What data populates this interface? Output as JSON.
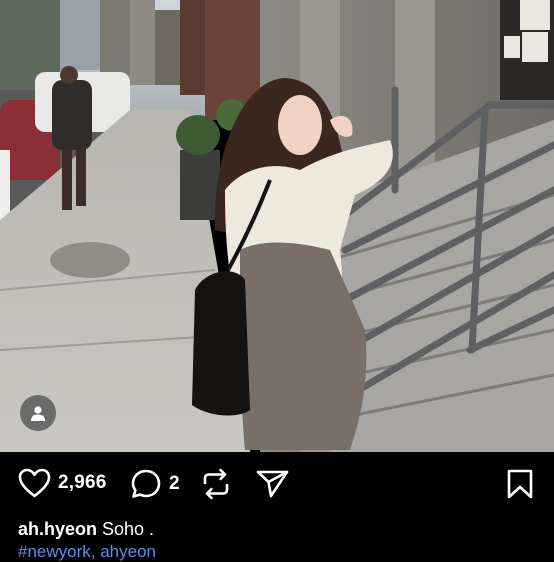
{
  "post": {
    "tag_icon": "person-icon"
  },
  "actions": {
    "like_count": "2,966",
    "comment_count": "2",
    "like_icon": "heart-icon",
    "comment_icon": "comment-bubble-icon",
    "repost_icon": "repost-icon",
    "share_icon": "send-icon",
    "save_icon": "bookmark-icon"
  },
  "caption": {
    "username": "ah.hyeon",
    "text": " Soho ."
  },
  "hashtags": "#newyork, ahyeon",
  "colors": {
    "background": "#000000",
    "hashtag": "#5b8fe8"
  }
}
